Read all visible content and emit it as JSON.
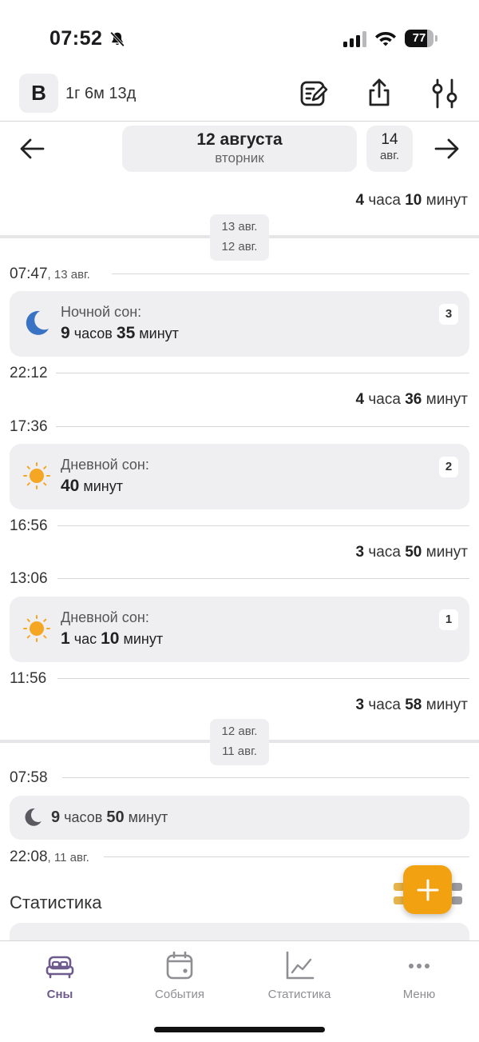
{
  "status_bar": {
    "time": "07:52",
    "battery": "77",
    "battery_level": 0.77
  },
  "header": {
    "avatar_letter": "В",
    "age": "1г 6м 13д"
  },
  "date_nav": {
    "current_date": "12 августа",
    "current_weekday": "вторник",
    "next_day": "14",
    "next_month": "авг."
  },
  "timeline": {
    "top_gap": {
      "num1": "4",
      "unit1": "часа",
      "num2": "10",
      "unit2": "минут"
    },
    "badge1": {
      "top": "13 авг.",
      "bottom": "12 авг."
    },
    "t1": {
      "time": "07:47",
      "date": ", 13 авг."
    },
    "card1": {
      "label": "Ночной сон:",
      "n1": "9",
      "u1": "часов",
      "n2": "35",
      "u2": "минут",
      "num": "3"
    },
    "t2": {
      "time": "22:12"
    },
    "gap2": {
      "num1": "4",
      "unit1": "часа",
      "num2": "36",
      "unit2": "минут"
    },
    "t3": {
      "time": "17:36"
    },
    "card2": {
      "label": "Дневной сон:",
      "n1": "40",
      "u1": "минут",
      "num": "2"
    },
    "t4": {
      "time": "16:56"
    },
    "gap3": {
      "num1": "3",
      "unit1": "часа",
      "num2": "50",
      "unit2": "минут"
    },
    "t5": {
      "time": "13:06"
    },
    "card3": {
      "label": "Дневной сон:",
      "n1": "1",
      "u1": "час",
      "n2": "10",
      "u2": "минут",
      "num": "1"
    },
    "t6": {
      "time": "11:56"
    },
    "gap4": {
      "num1": "3",
      "unit1": "часа",
      "num2": "58",
      "unit2": "минут"
    },
    "badge2": {
      "top": "12 авг.",
      "bottom": "11 авг."
    },
    "t7": {
      "time": "07:58"
    },
    "card4": {
      "n1": "9",
      "u1": "часов",
      "n2": "50",
      "u2": "минут"
    },
    "t8": {
      "time": "22:08",
      "date": ", 11 авг."
    }
  },
  "statistics_title": "Статистика",
  "fab_label": "+",
  "tabs": [
    {
      "label": "Сны",
      "icon": "bed-icon",
      "active": true
    },
    {
      "label": "События",
      "icon": "calendar-icon",
      "active": false
    },
    {
      "label": "Статистика",
      "icon": "chart-icon",
      "active": false
    },
    {
      "label": "Меню",
      "icon": "more-icon",
      "active": false
    }
  ],
  "colors": {
    "accent": "#f2a211",
    "tab_active": "#6e5a8c",
    "moon": "#3b73c4",
    "sun": "#f5a623"
  }
}
